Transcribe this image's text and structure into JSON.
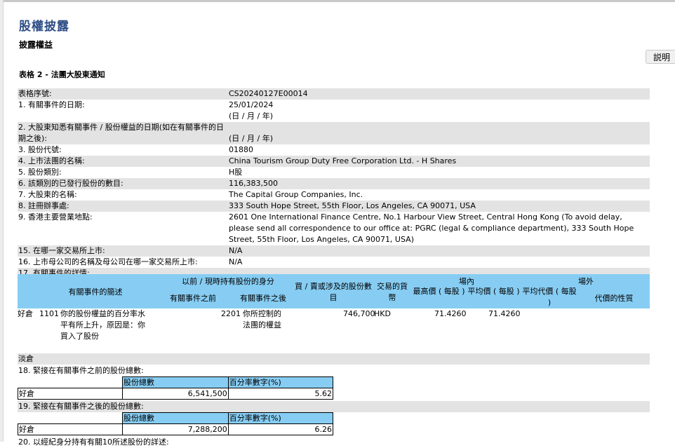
{
  "page": {
    "title": "股權披露",
    "subtitle": "披露權益",
    "help_button": "説明",
    "form_title": "表格 2 - 法團大股東通知"
  },
  "details": [
    {
      "label": "表格序號:",
      "value": "CS20240127E00014"
    },
    {
      "label": "1. 有關事件的日期:",
      "value": "25/01/2024",
      "hint": "(日 / 月 / 年)"
    },
    {
      "label": "2. 大股東知悉有關事件 / 股份權益的日期(如在有關事件的日期之後):",
      "value": "",
      "hint": "(日 / 月 / 年)"
    },
    {
      "label": "3. 股份代號:",
      "value": "01880"
    },
    {
      "label": "4. 上市法團的名稱:",
      "value": "China Tourism Group Duty Free Corporation Ltd. - H Shares"
    },
    {
      "label": "5. 股份類別:",
      "value": "H股"
    },
    {
      "label": "6. 該類別的已發行股份的數目:",
      "value": "116,383,500"
    },
    {
      "label": "7. 大股東的名稱:",
      "value": "The Capital Group Companies, Inc."
    },
    {
      "label": "8. 註冊辦事處:",
      "value": "333 South Hope Street, 55th Floor, Los Angeles, CA 90071, USA"
    },
    {
      "label": "9. 香港主要營業地點:",
      "value": "2601 One International Finance Centre, No.1 Harbour View Street, Central Hong Kong (To avoid delay, please send all correspondence to our office at: PGRC (legal & compliance department), 333 South Hope Street, 55th Floor, Los Angeles, CA 90071, USA)"
    },
    {
      "label": "15. 在哪一家交易所上市:",
      "value": "N/A"
    },
    {
      "label": "16. 上市母公司的名稱及母公司在哪一家交易所上市:",
      "value": "N/A"
    },
    {
      "label": "17. 有關事件的詳情:",
      "value": ""
    }
  ],
  "event_table": {
    "headers": {
      "event_code": "有關事件的簡述",
      "capacity_group": "以前 / 現時持有股份的身分",
      "before": "有關事件之前",
      "after": "有關事件之後",
      "shares": "買 / 賣或涉及的股份數目",
      "currency": "交易的貨幣",
      "onexchange": "場內",
      "high": "最高價 ( 每股 )",
      "avg": "平均價 ( 每股 )",
      "offexchange": "場外",
      "avg_consideration": "平均代價 ( 每股 )",
      "nature": "代價的性質"
    },
    "row": {
      "position": "好倉",
      "event_code": "1101",
      "event_desc": "你的股份權益的百分率水平有所上升，原因是：你買入了股份",
      "capacity_before_code": "2201",
      "capacity_after": "你所控制的法團的權益",
      "shares": "746,700",
      "currency": "HKD",
      "high": "71.4260",
      "avg": "71.4260"
    },
    "short_position": "淡倉"
  },
  "section18": {
    "label": "18. 緊接在有關事件之前的股份總數:",
    "col_shares": "股份總數",
    "col_pct": "百分率數字(%)",
    "position": "好倉",
    "shares": "6,541,500",
    "pct": "5.62"
  },
  "section19": {
    "label": "19. 緊接在有關事件之後的股份總數:",
    "col_shares": "股份總數",
    "col_pct": "百分率數字(%)",
    "position": "好倉",
    "shares": "7,288,200",
    "pct": "6.26"
  },
  "section20": {
    "label": "20. 以經紀身分持有有關10所述股份的詳述:"
  },
  "colors": {
    "header_blue": "#87cdf3",
    "row_gray": "#e3e3e3",
    "title_blue": "#2f4f86"
  }
}
